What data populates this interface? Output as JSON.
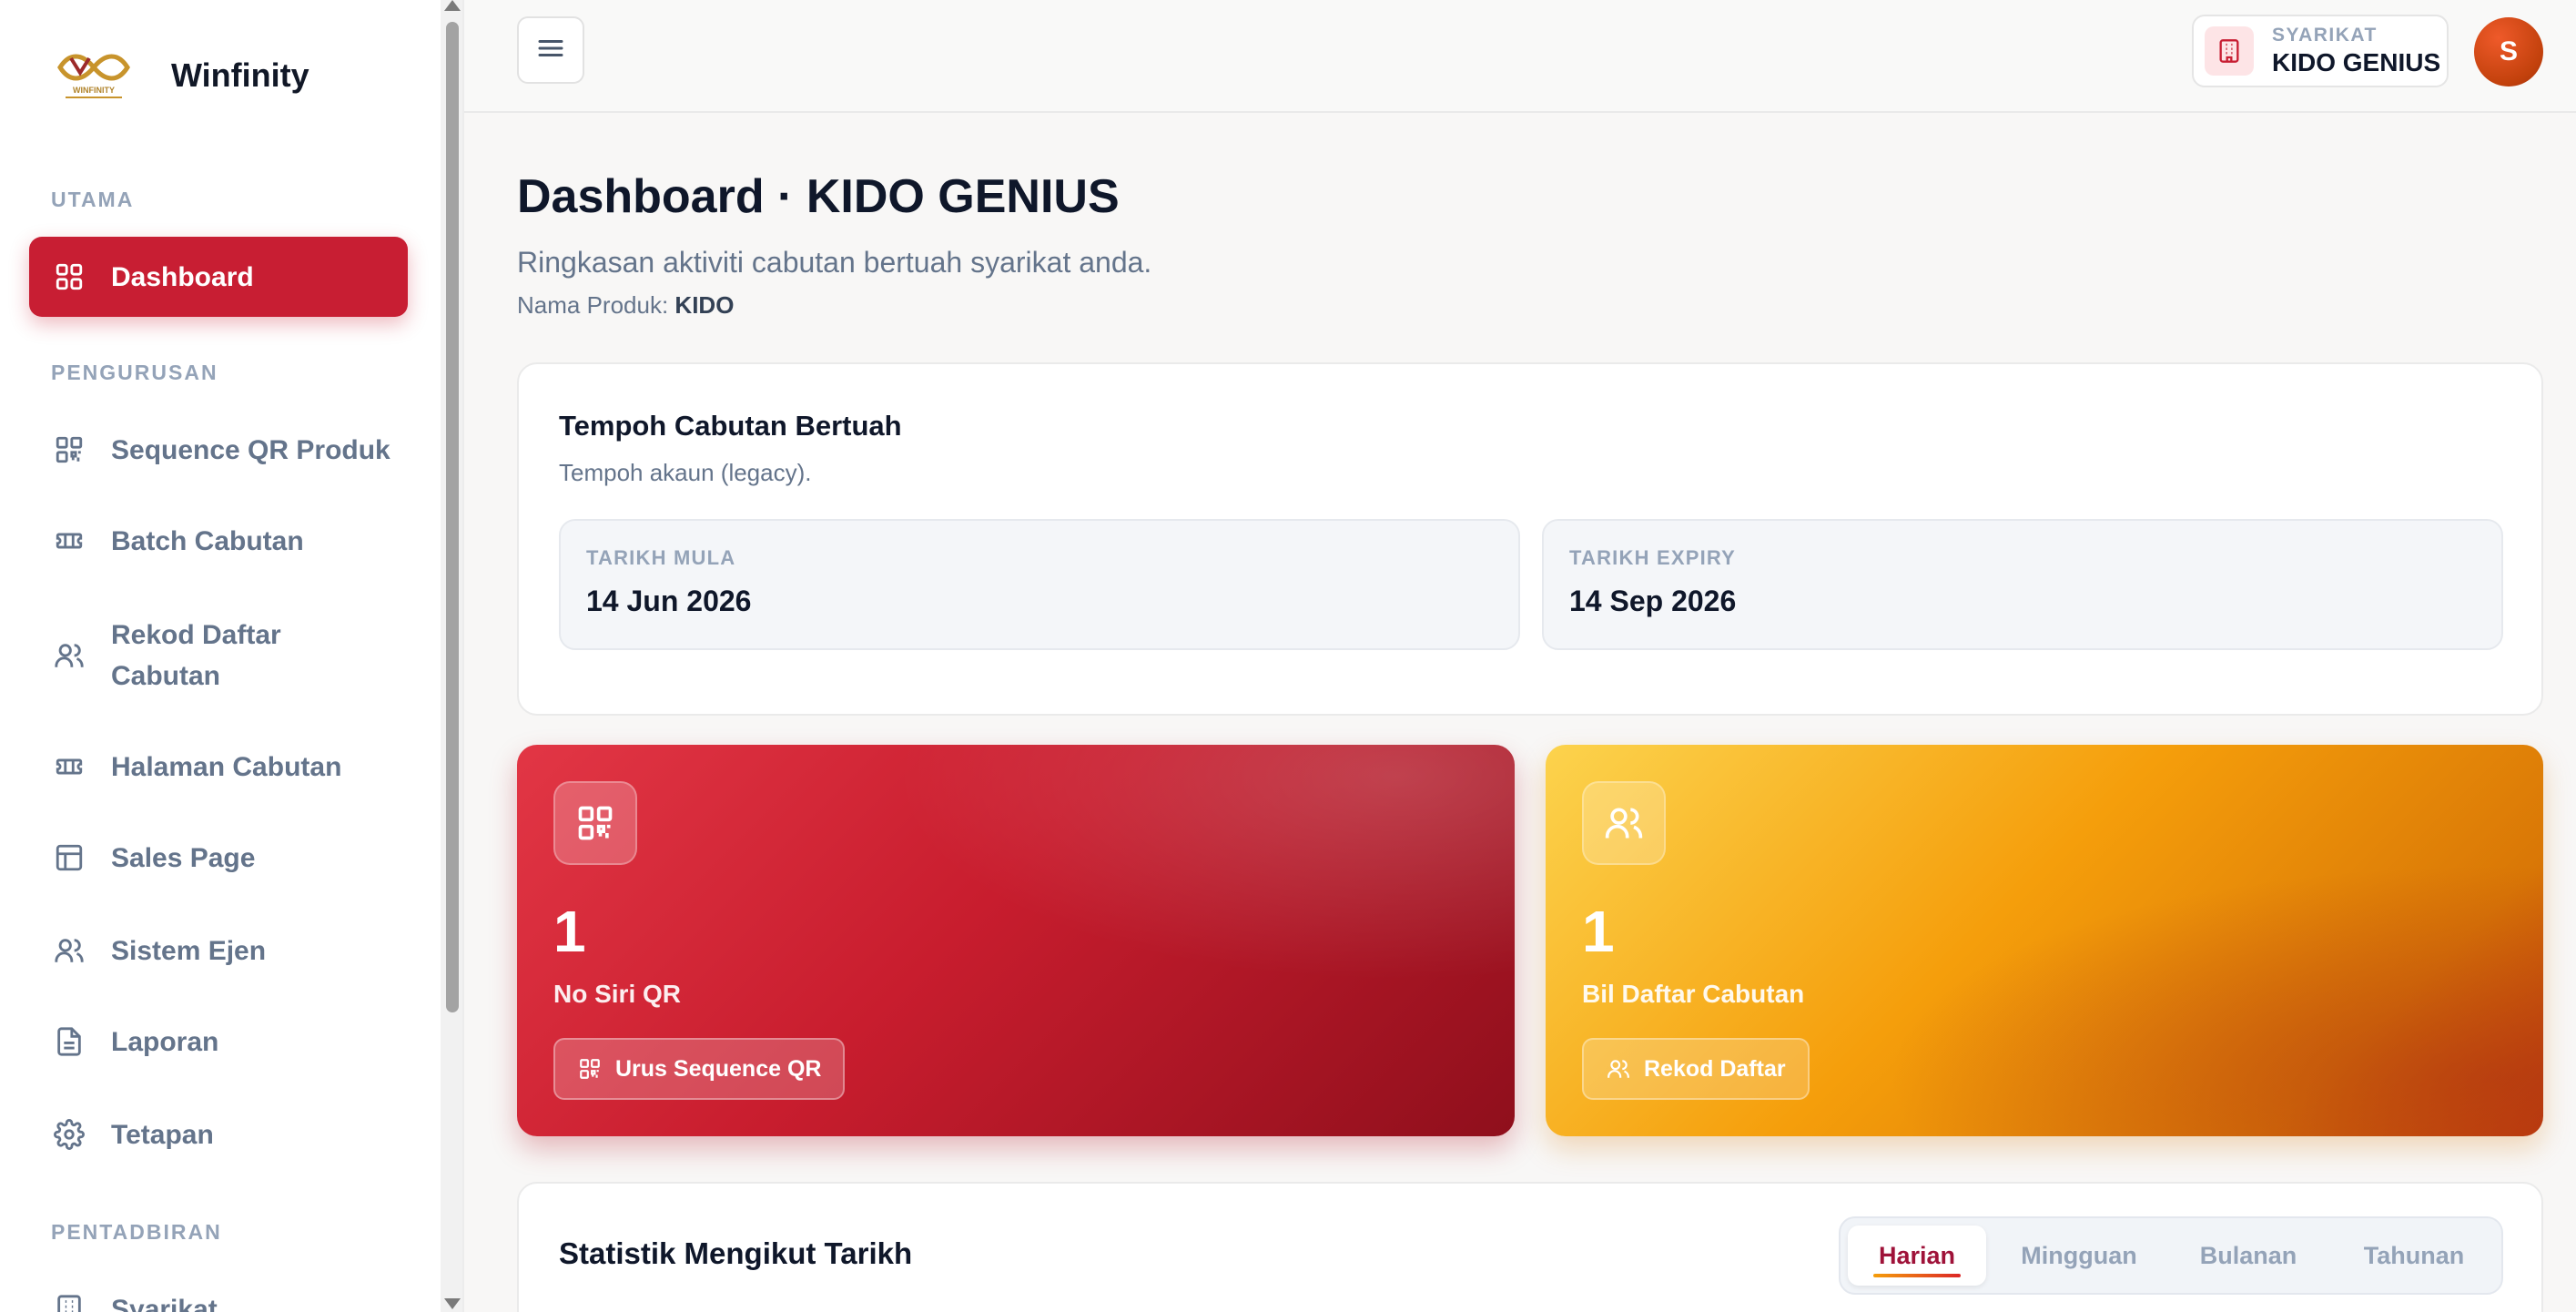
{
  "brand": {
    "name": "Winfinity",
    "logo_text": "WINFINITY"
  },
  "sidebar": {
    "sections": {
      "utama": "UTAMA",
      "pengurusan": "PENGURUSAN",
      "pentadbiran": "PENTADBIRAN"
    },
    "items": [
      {
        "label": "Dashboard",
        "icon": "grid-icon",
        "active": true
      },
      {
        "label": "Sequence QR Produk",
        "icon": "qr-icon"
      },
      {
        "label": "Batch Cabutan",
        "icon": "ticket-icon"
      },
      {
        "label": "Rekod Daftar Cabutan",
        "icon": "users-icon"
      },
      {
        "label": "Halaman Cabutan",
        "icon": "ticket-icon"
      },
      {
        "label": "Sales Page",
        "icon": "layout-icon"
      },
      {
        "label": "Sistem Ejen",
        "icon": "users-icon"
      },
      {
        "label": "Laporan",
        "icon": "document-icon"
      },
      {
        "label": "Tetapan",
        "icon": "gear-icon"
      },
      {
        "label": "Syarikat",
        "icon": "building-icon"
      }
    ]
  },
  "header": {
    "company_label": "SYARIKAT",
    "company_name": "KIDO GENIUS",
    "avatar_initial": "S"
  },
  "page": {
    "title": "Dashboard · KIDO GENIUS",
    "subtitle": "Ringkasan aktiviti cabutan bertuah syarikat anda.",
    "product_label": "Nama Produk:",
    "product_name": "KIDO"
  },
  "period": {
    "title": "Tempoh Cabutan Bertuah",
    "subtitle": "Tempoh akaun (legacy).",
    "start_label": "TARIKH MULA",
    "start_value": "14 Jun 2026",
    "expiry_label": "TARIKH EXPIRY",
    "expiry_value": "14 Sep 2026"
  },
  "stats": [
    {
      "value": "1",
      "label": "No Siri QR",
      "button": "Urus Sequence QR",
      "icon": "qr-icon"
    },
    {
      "value": "1",
      "label": "Bil Daftar Cabutan",
      "button": "Rekod Daftar",
      "icon": "users-icon"
    }
  ],
  "statistics": {
    "title": "Statistik Mengikut Tarikh",
    "tabs": [
      "Harian",
      "Mingguan",
      "Bulanan",
      "Tahunan"
    ],
    "active_tab": "Harian"
  },
  "colors": {
    "accent": "#c81e33",
    "warning": "#f59e0b"
  }
}
